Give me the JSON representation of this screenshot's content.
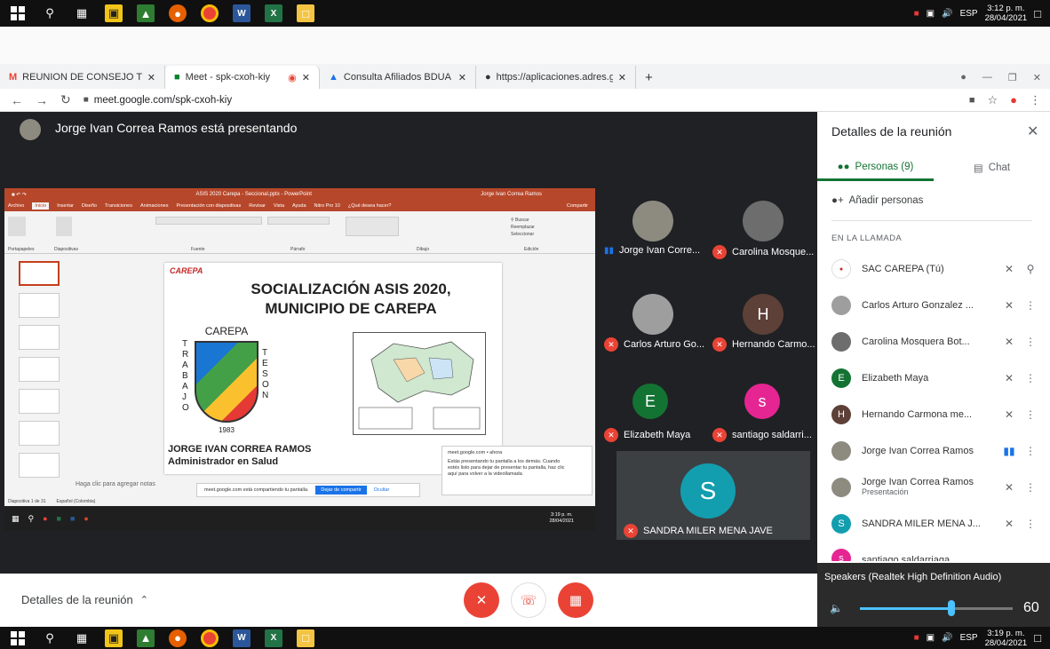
{
  "colors": {
    "meet_dark": "#202124",
    "meet_red": "#ea4335",
    "meet_blue": "#1a73e8",
    "ppt_red": "#c43e1c",
    "avatar_green": "#137333",
    "avatar_brown": "#5d4037",
    "avatar_pink": "#e52592",
    "avatar_teal": "#129eaf"
  },
  "taskbar_top": {
    "time": "3:12 p. m.",
    "date": "28/04/2021",
    "lang": "ESP"
  },
  "taskbar_bottom": {
    "time": "3:19 p. m.",
    "date": "28/04/2021",
    "lang": "ESP"
  },
  "browser": {
    "tabs": [
      {
        "label": "REUNION DE CONSEJO TERRITO",
        "icon": "gmail-icon"
      },
      {
        "label": "Meet - spk-cxoh-kiy",
        "icon": "meet-icon"
      },
      {
        "label": "Consulta Afiliados BDUA",
        "icon": "drive-icon"
      },
      {
        "label": "https://aplicaciones.adres.gov.co",
        "icon": "globe-icon"
      }
    ],
    "url": "meet.google.com/spk-cxoh-kiy"
  },
  "stage": {
    "presenter_banner": "Jorge Ivan Correa Ramos está presentando",
    "tiles": [
      {
        "name": "Jorge Ivan Corre..."
      },
      {
        "name": "Carolina Mosque..."
      },
      {
        "name": "Carlos Arturo Go..."
      },
      {
        "name": "Hernando Carmo...",
        "initial": "H"
      },
      {
        "name": "Elizabeth Maya",
        "initial": "E"
      },
      {
        "name": "santiago saldarri...",
        "initial": "s"
      }
    ],
    "big_tile": {
      "name": "SANDRA MILER MENA JAVE",
      "initial": "S"
    }
  },
  "ppt": {
    "title": "ASIS 2020 Carepa - Seccional.pptx - PowerPoint",
    "user": "Jorge Ivan Correa Ramos",
    "tabs": [
      "Archivo",
      "Inicio",
      "Insertar",
      "Diseño",
      "Transiciones",
      "Animaciones",
      "Presentación con diapositivas",
      "Revisar",
      "Vista",
      "Ayuda",
      "Nitro Pro 10",
      "¿Qué desea hacer?"
    ],
    "share_label": "Compartir",
    "groups": [
      "Portapapeles",
      "Diapositivas",
      "Fuente",
      "Párrafo",
      "Dibujo",
      "Edición"
    ],
    "slide": {
      "heading_line1": "SOCIALIZACIÓN ASIS 2020,",
      "heading_line2": "MUNICIPIO DE CAREPA",
      "shield_title": "CAREPA",
      "shield_left": "TRABAJO",
      "shield_right": "TESON",
      "shield_year": "1983",
      "presenter_name": "JORGE IVAN CORREA RAMOS",
      "presenter_role": "Administrador en Salud",
      "logo": "CAREPA"
    },
    "notes_placeholder": "Haga clic para agregar notas",
    "status_left": "Diapositiva 1 de 31",
    "status_lang": "Español (Colombia)",
    "share_bar_text": "meet.google.com está compartiendo tu pantalla.",
    "share_bar_stop": "Dejar de compartir",
    "share_bar_hide": "Ocultar",
    "notification": {
      "source": "meet.google.com • ahora",
      "body": "Estás presentando tu pantalla a los demás. Cuando estés listo para dejar de presentar tu pantalla, haz clic aquí para volver a la videollamada"
    },
    "inner_clock": "3:19 p. m.",
    "inner_date": "28/04/2021"
  },
  "panel": {
    "title": "Detalles de la reunión",
    "tab_people": "Personas (9)",
    "tab_chat": "Chat",
    "add_people": "Añadir personas",
    "section": "EN LA LLAMADA",
    "people": [
      {
        "name": "SAC CAREPA (Tú)",
        "initial": "",
        "color": "#ffffff"
      },
      {
        "name": "Carlos Arturo Gonzalez ...",
        "initial": "",
        "color": "#9e9e9e"
      },
      {
        "name": "Carolina Mosquera Bot...",
        "initial": "",
        "color": "#6d6d6d"
      },
      {
        "name": "Elizabeth Maya",
        "initial": "E",
        "color": "#137333"
      },
      {
        "name": "Hernando Carmona me...",
        "initial": "H",
        "color": "#5d4037"
      },
      {
        "name": "Jorge Ivan Correa Ramos",
        "initial": "",
        "color": "#8d8a80"
      },
      {
        "name": "Jorge Ivan Correa Ramos",
        "sub": "Presentación",
        "initial": "",
        "color": "#8d8a80"
      },
      {
        "name": "SANDRA MILER MENA J...",
        "initial": "S",
        "color": "#129eaf"
      },
      {
        "name": "santiago saldarriaga",
        "initial": "s",
        "color": "#e52592"
      }
    ]
  },
  "volume": {
    "label": "Speakers (Realtek High Definition Audio)",
    "value": "60",
    "level": 0.6
  },
  "bottombar": {
    "details": "Detalles de la reunión"
  }
}
